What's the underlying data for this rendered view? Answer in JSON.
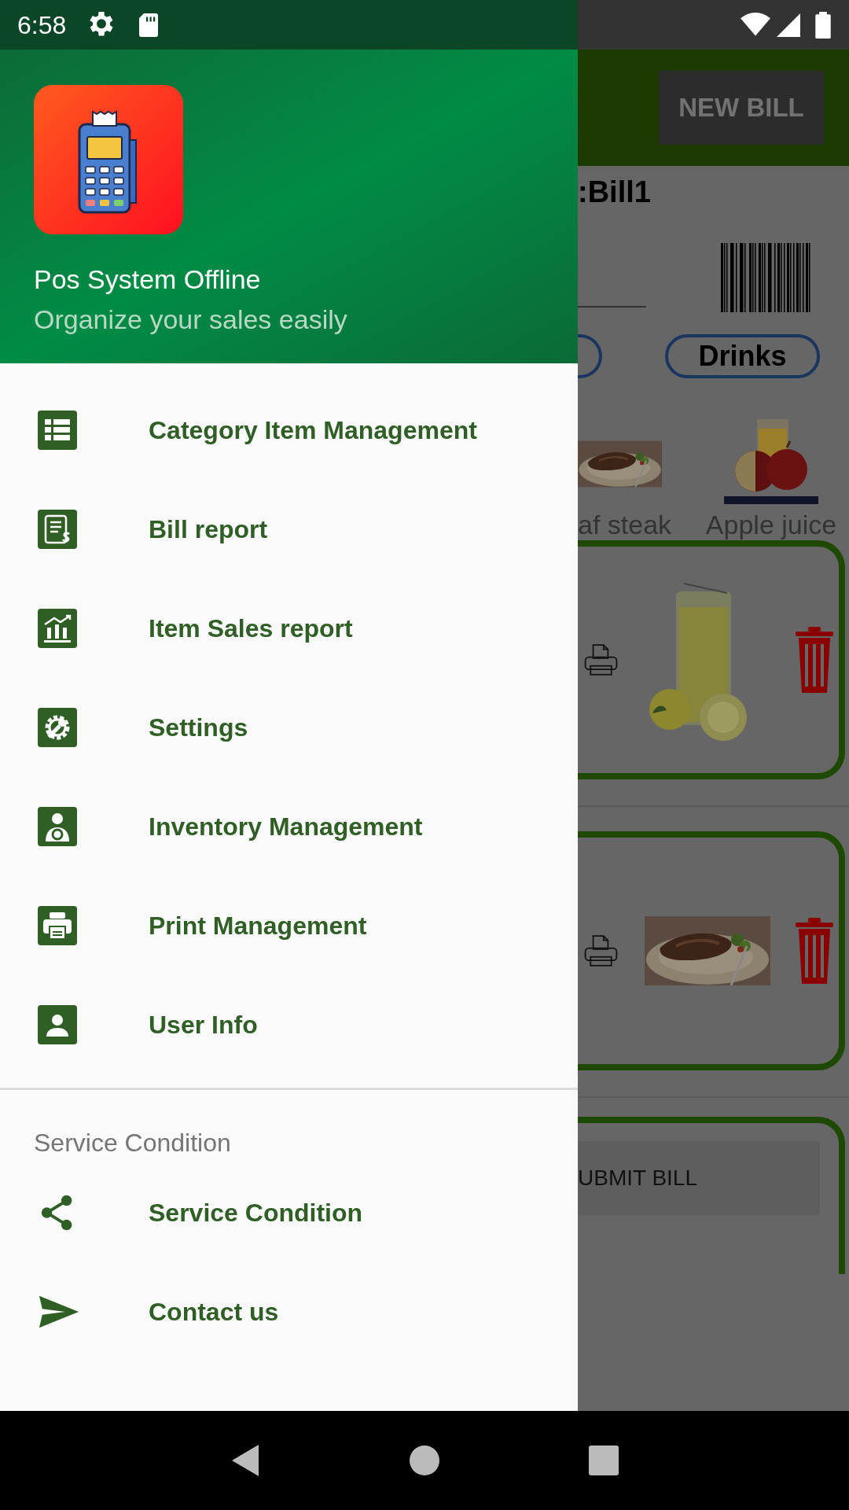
{
  "status_bar": {
    "time": "6:58"
  },
  "drawer": {
    "app_name": "Pos System Offline",
    "tagline": "Organize your sales easily",
    "menu": [
      {
        "label": "Category Item Management"
      },
      {
        "label": "Bill report"
      },
      {
        "label": "Item Sales report"
      },
      {
        "label": "Settings"
      },
      {
        "label": "Inventory Management"
      },
      {
        "label": "Print Management"
      },
      {
        "label": "User Info"
      }
    ],
    "section_title": "Service Condition",
    "section_items": [
      {
        "label": "Service Condition"
      },
      {
        "label": "Contact us"
      }
    ]
  },
  "background": {
    "new_bill_button": "NEW BILL",
    "bill_title": ":Bill1",
    "category": "Drinks",
    "products": [
      {
        "name": "af steak",
        "kind": "steak"
      },
      {
        "name": "Apple juice",
        "kind": "juice"
      }
    ],
    "bill_items": [
      {
        "kind": "lemonade"
      },
      {
        "kind": "steak"
      }
    ],
    "submit_button": "UBMIT BILL"
  }
}
